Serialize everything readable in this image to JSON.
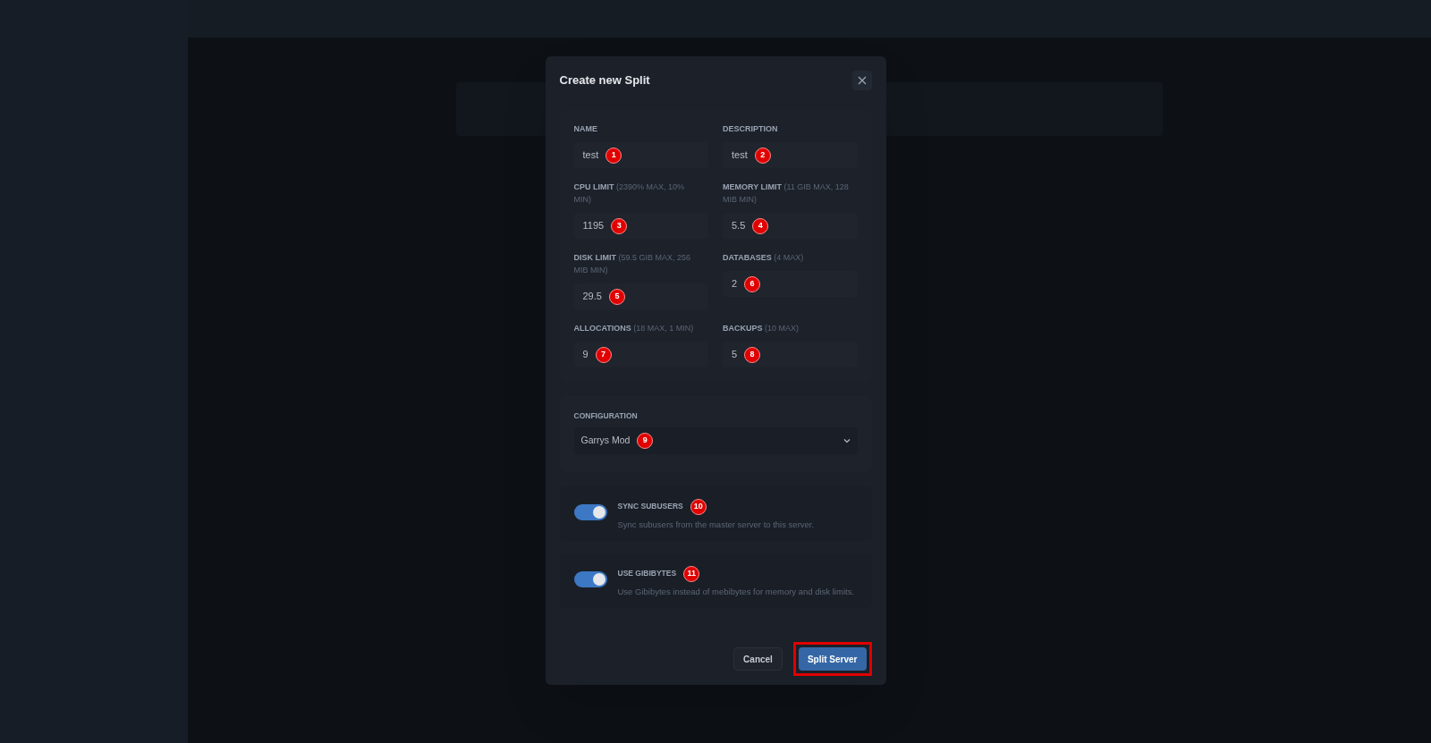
{
  "dialog": {
    "title": "Create new Split",
    "fields": [
      {
        "label": "NAME",
        "value": "test",
        "marker": "1"
      },
      {
        "label": "DESCRIPTION",
        "value": "test",
        "marker": "2"
      },
      {
        "label": "CPU LIMIT",
        "hint": "(2390% MAX, 10% MIN)",
        "value": "1195",
        "marker": "3"
      },
      {
        "label": "MEMORY LIMIT",
        "hint": "(11 GIB MAX, 128 MIB MIN)",
        "value": "5.5",
        "marker": "4"
      },
      {
        "label": "DISK LIMIT",
        "hint": "(59.5 GIB MAX, 256 MIB MIN)",
        "value": "29.5",
        "marker": "5"
      },
      {
        "label": "DATABASES",
        "hint": "(4 MAX)",
        "value": "2",
        "marker": "6"
      },
      {
        "label": "ALLOCATIONS",
        "hint": "(18 MAX, 1 MIN)",
        "value": "9",
        "marker": "7"
      },
      {
        "label": "BACKUPS",
        "hint": "(10 MAX)",
        "value": "5",
        "marker": "8"
      }
    ],
    "configuration": {
      "label": "CONFIGURATION",
      "value": "Garrys Mod",
      "marker": "9"
    },
    "toggles": [
      {
        "label": "SYNC SUBUSERS",
        "description": "Sync subusers from the master server to this server.",
        "on": true,
        "marker": "10"
      },
      {
        "label": "USE GIBIBYTES",
        "description": "Use Gibibytes instead of mebibytes for memory and disk limits.",
        "on": true,
        "marker": "11"
      }
    ],
    "buttons": [
      {
        "label": "Cancel",
        "kind": "secondary",
        "highlighted": false
      },
      {
        "label": "Split Server",
        "kind": "primary",
        "highlighted": true
      }
    ]
  }
}
